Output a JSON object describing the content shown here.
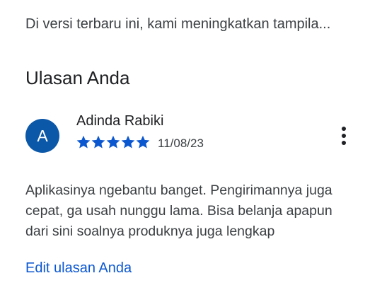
{
  "whats_new": {
    "text": "Di versi terbaru ini, kami meningkatkan tampila..."
  },
  "section": {
    "title": "Ulasan Anda"
  },
  "review": {
    "avatar_initial": "A",
    "author": "Adinda Rabiki",
    "rating": 5,
    "max_rating": 5,
    "date": "11/08/23",
    "text": "Aplikasinya ngebantu banget. Pengirimannya juga cepat, ga usah nunggu lama. Bisa belanja apapun dari sini soalnya produknya juga lengkap",
    "more_icon": "more-vert-icon",
    "star_icon": "star-filled-icon"
  },
  "actions": {
    "edit_label": "Edit ulasan Anda"
  },
  "colors": {
    "accent": "#0b57d0",
    "avatar_bg": "#0b57a8",
    "star": "#0b57d0"
  }
}
